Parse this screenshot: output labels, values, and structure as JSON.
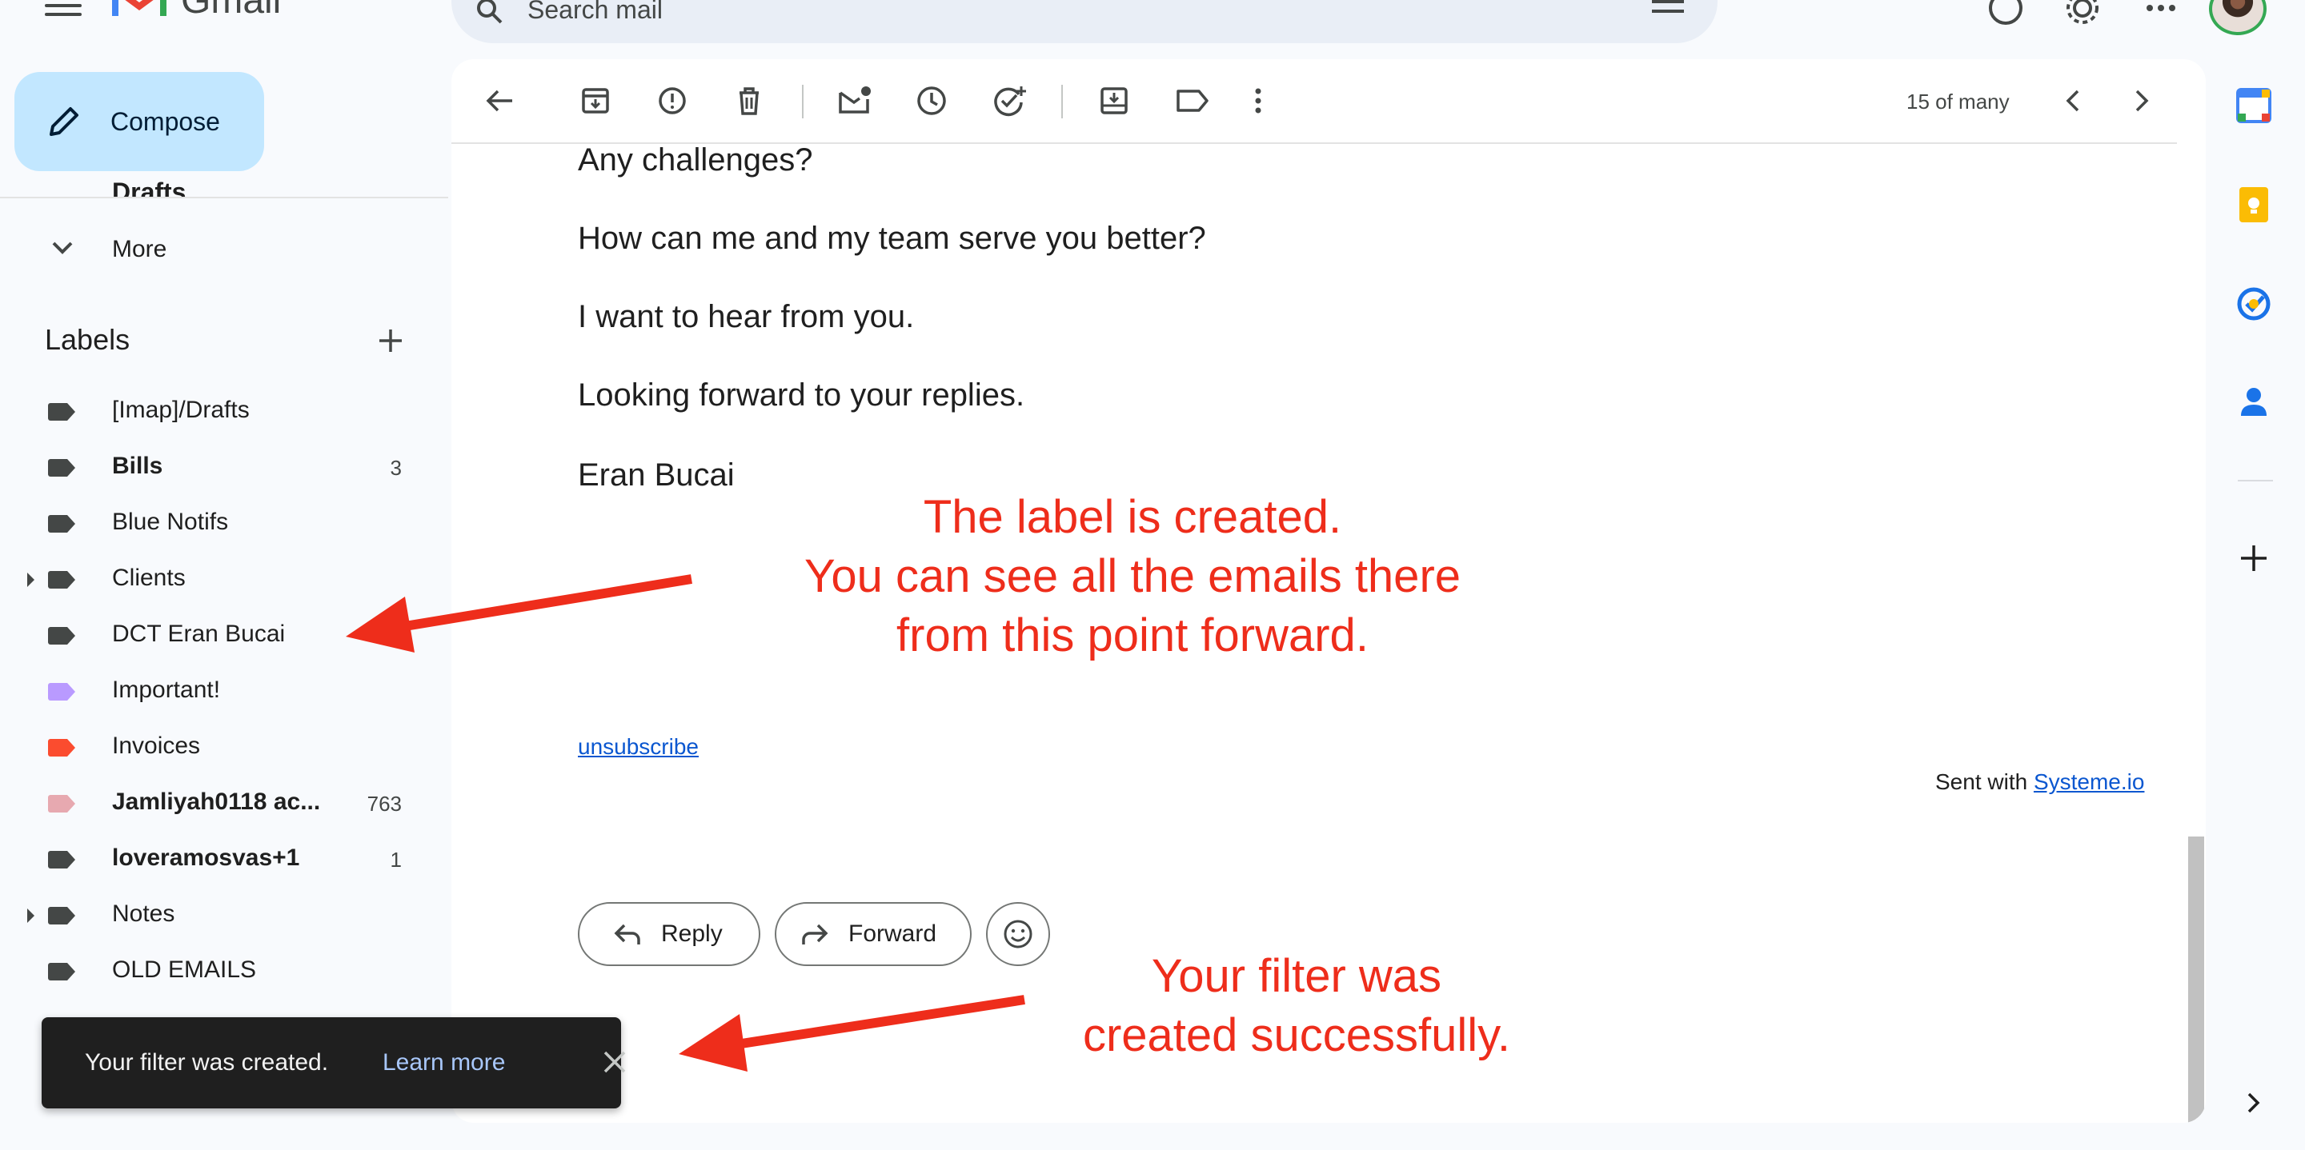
{
  "app": {
    "name": "Gmail"
  },
  "search": {
    "placeholder": "Search mail"
  },
  "compose": {
    "label": "Compose"
  },
  "sidebar": {
    "drafts_label": "Drafts",
    "more_label": "More",
    "labels_heading": "Labels",
    "labels": [
      {
        "name": "[Imap]/Drafts",
        "bold": false,
        "count": "",
        "color": "#444746",
        "expandable": false
      },
      {
        "name": "Bills",
        "bold": true,
        "count": "3",
        "color": "#444746",
        "expandable": false
      },
      {
        "name": "Blue Notifs",
        "bold": false,
        "count": "",
        "color": "#444746",
        "expandable": false
      },
      {
        "name": "Clients",
        "bold": false,
        "count": "",
        "color": "#444746",
        "expandable": true
      },
      {
        "name": "DCT Eran Bucai",
        "bold": false,
        "count": "",
        "color": "#444746",
        "expandable": false
      },
      {
        "name": "Important!",
        "bold": false,
        "count": "",
        "color": "#b99aff",
        "expandable": false
      },
      {
        "name": "Invoices",
        "bold": false,
        "count": "",
        "color": "#fb4c2f",
        "expandable": false
      },
      {
        "name": "Jamliyah0118 ac...",
        "bold": true,
        "count": "763",
        "color": "#e7a9b0",
        "expandable": false
      },
      {
        "name": "loveramosvas+1",
        "bold": true,
        "count": "1",
        "color": "#444746",
        "expandable": false
      },
      {
        "name": "Notes",
        "bold": false,
        "count": "",
        "color": "#444746",
        "expandable": true
      },
      {
        "name": "OLD EMAILS",
        "bold": false,
        "count": "",
        "color": "#444746",
        "expandable": false
      }
    ]
  },
  "toolbar": {
    "pager_text": "15 of many"
  },
  "email": {
    "lines": [
      "Any challenges?",
      "How can me and my team serve you better?",
      "I want to hear from you.",
      "Looking forward to your replies.",
      "Eran Bucai"
    ],
    "unsubscribe": "unsubscribe",
    "sent_with_prefix": "Sent with ",
    "sent_with_link": "Systeme.io"
  },
  "actions": {
    "reply": "Reply",
    "forward": "Forward"
  },
  "snackbar": {
    "message": "Your filter was created.",
    "link": "Learn more"
  },
  "annotations": {
    "label_note": [
      "The label is created.",
      "You can see all the emails there",
      "from this point forward."
    ],
    "filter_note": [
      "Your filter was",
      "created successfully."
    ]
  },
  "colors": {
    "annotation": "#ee2d1b",
    "compose_bg": "#c2e7ff",
    "link": "#0b57d0"
  }
}
